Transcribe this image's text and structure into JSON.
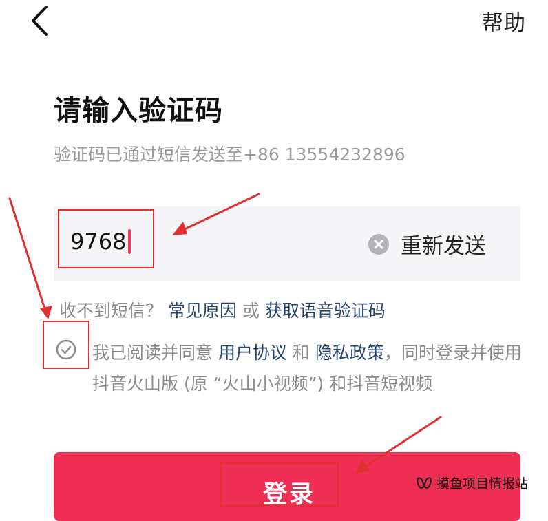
{
  "header": {
    "back_icon": "chevron-left-icon",
    "help_label": "帮助"
  },
  "main": {
    "title": "请输入验证码",
    "subtitle": "验证码已通过短信发送至+86 13554232896"
  },
  "code_input": {
    "value": "9768",
    "clear_icon": "clear-circle-icon",
    "resend_label": "重新发送",
    "caret_color": "#ea3d5e"
  },
  "sms_help": {
    "prefix": "收不到短信？",
    "common_reasons_link": "常见原因",
    "or_text": "或",
    "voice_code_link": "获取语音验证码"
  },
  "agreement": {
    "check_icon": "check-circle-icon",
    "text_1": "我已阅读并同意 ",
    "user_agreement_link": "用户协议",
    "and_text": " 和 ",
    "privacy_policy_link": "隐私政策",
    "text_2": "，同时登录并使用抖音火山版 (原 “火山小视频”) 和抖音短视频"
  },
  "login_button": {
    "label": "登录",
    "color": "#ee2e52"
  },
  "watermark": {
    "text": "摸鱼项目情报站",
    "icon": "wechat-channel-icon"
  },
  "colors": {
    "accent": "#ee2e52",
    "link": "#27456c",
    "annotation": "#e23030"
  }
}
